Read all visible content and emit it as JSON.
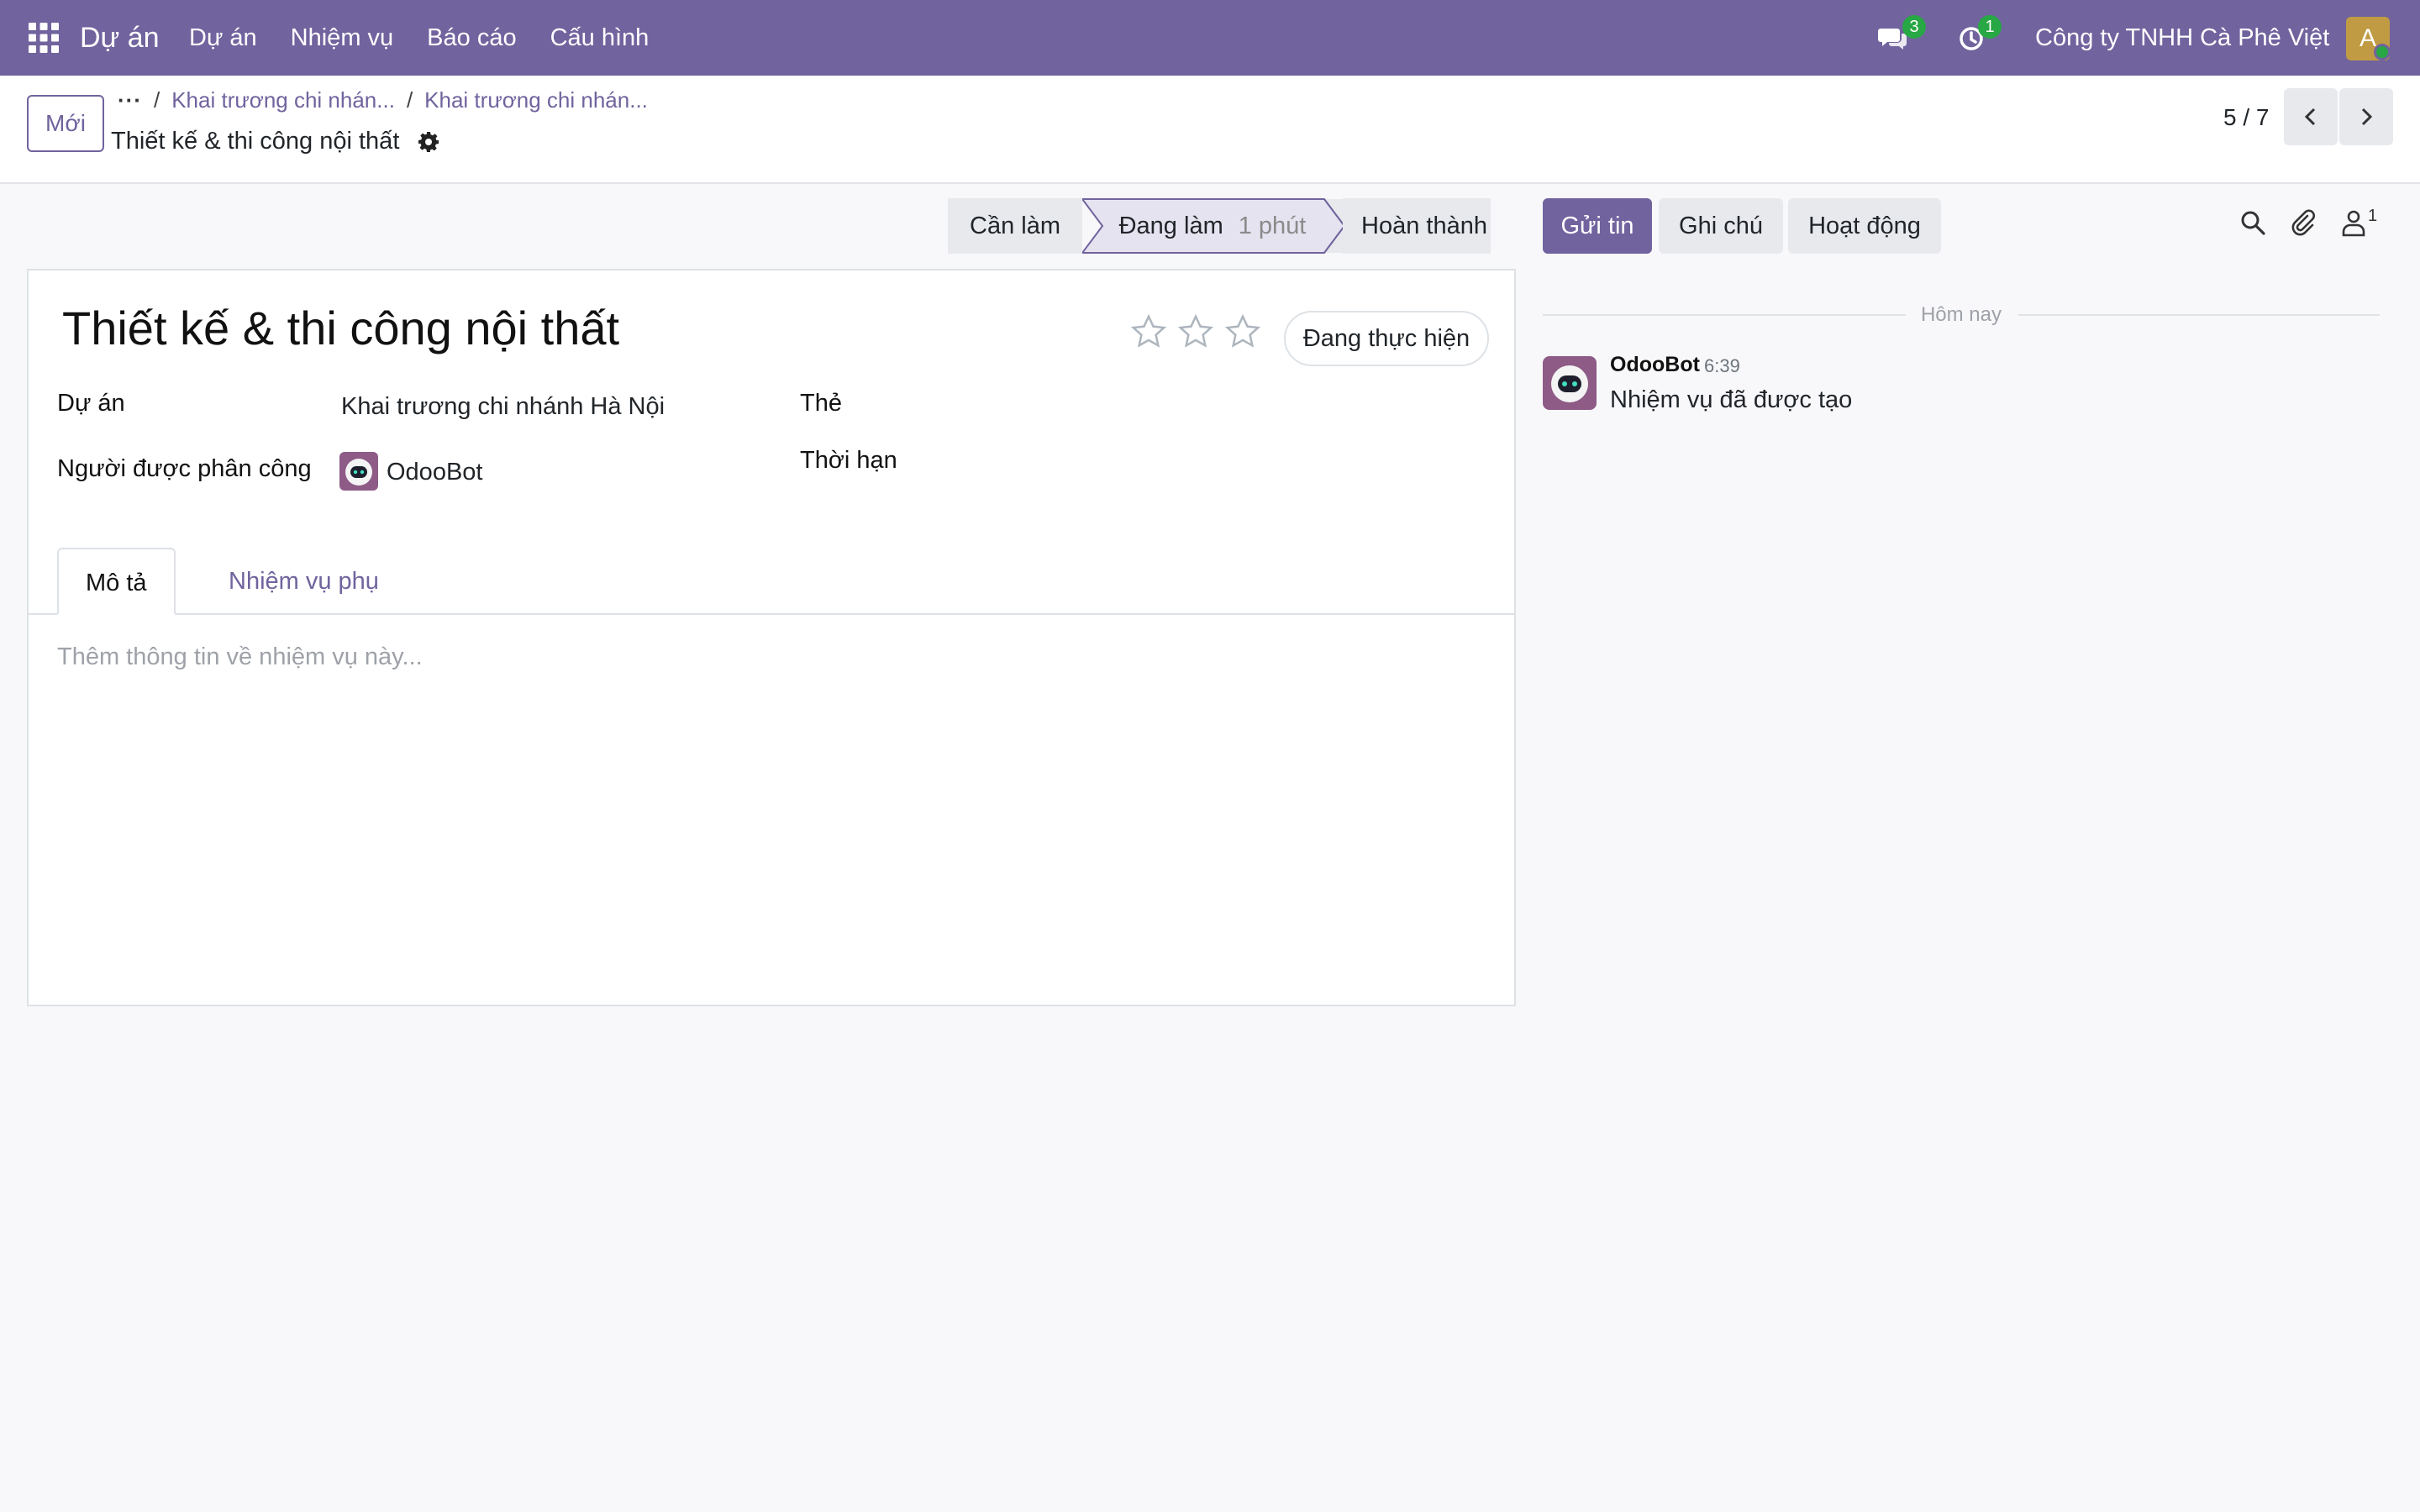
{
  "navbar": {
    "app_name": "Dự án",
    "menu": [
      "Dự án",
      "Nhiệm vụ",
      "Báo cáo",
      "Cấu hình"
    ],
    "messages_count": "3",
    "activities_count": "1",
    "company": "Công ty TNHH Cà Phê Việt",
    "user_initial": "A",
    "accent_color": "#71639e"
  },
  "control": {
    "new_button": "Mới",
    "breadcrumb_more": "···",
    "breadcrumbs": [
      "Khai trương chi nhán...",
      "Khai trương chi nhán..."
    ],
    "separator": "/",
    "current_record": "Thiết kế & thi công nội thất",
    "pager": "5 / 7"
  },
  "statusbar": {
    "stages": [
      "Cần làm",
      "Đang làm",
      "Hoàn thành"
    ],
    "active_stage": "Đang làm",
    "active_duration": "1 phút"
  },
  "form": {
    "title": "Thiết kế & thi công nội thất",
    "priority_stars_total": 3,
    "priority_stars_filled": 0,
    "state_button": "Đang thực hiện",
    "fields": {
      "project_label": "Dự án",
      "project_value": "Khai trương chi nhánh Hà Nội",
      "assignee_label": "Người được phân công",
      "assignee_value": "OdooBot",
      "tags_label": "Thẻ",
      "deadline_label": "Thời hạn"
    },
    "tabs": [
      "Mô tả",
      "Nhiệm vụ phụ"
    ],
    "description_placeholder": "Thêm thông tin về nhiệm vụ này..."
  },
  "chatter": {
    "send_message": "Gửi tin",
    "log_note": "Ghi chú",
    "activities": "Hoạt động",
    "followers_count": "1",
    "date_separator": "Hôm nay",
    "messages": [
      {
        "author": "OdooBot",
        "time": "6:39",
        "body": "Nhiệm vụ đã được tạo"
      }
    ]
  }
}
